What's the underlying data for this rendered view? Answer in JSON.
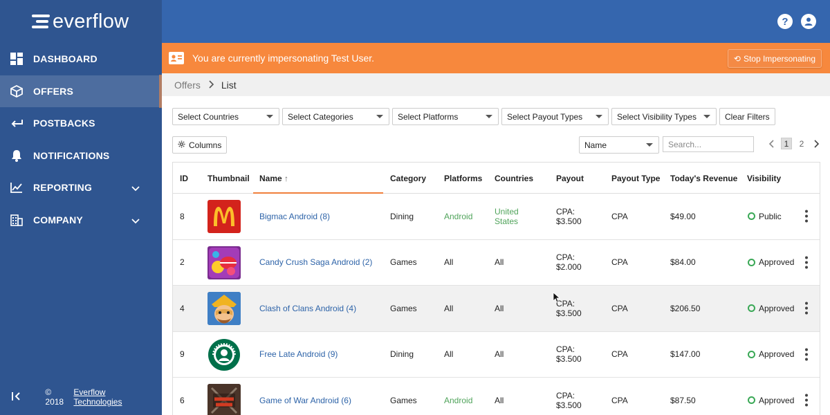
{
  "brand": {
    "name": "everflow"
  },
  "sidebar": {
    "items": [
      {
        "label": "DASHBOARD",
        "icon": "dashboard-icon"
      },
      {
        "label": "OFFERS",
        "icon": "cube-icon",
        "active": true
      },
      {
        "label": "POSTBACKS",
        "icon": "arrow-left-icon"
      },
      {
        "label": "NOTIFICATIONS",
        "icon": "bell-icon"
      },
      {
        "label": "REPORTING",
        "icon": "chart-icon",
        "expandable": true
      },
      {
        "label": "COMPANY",
        "icon": "building-icon",
        "expandable": true
      }
    ],
    "footer": {
      "copyright": "© 2018",
      "company_link": "Everflow Technologies"
    }
  },
  "topbar": {
    "help_glyph": "?"
  },
  "banner": {
    "text": "You are currently impersonating Test User.",
    "stop_button": "Stop Impersonating"
  },
  "breadcrumb": {
    "parent": "Offers",
    "current": "List"
  },
  "filters": {
    "countries": "Select Countries",
    "categories": "Select Categories",
    "platforms": "Select Platforms",
    "payout_types": "Select Payout Types",
    "visibility_types": "Select Visibility Types",
    "clear": "Clear Filters"
  },
  "toolbar": {
    "columns": "Columns",
    "sort_by": "Name",
    "search_placeholder": "Search...",
    "pages": [
      "1",
      "2"
    ]
  },
  "table": {
    "headers": {
      "id": "ID",
      "thumbnail": "Thumbnail",
      "name": "Name",
      "category": "Category",
      "platforms": "Platforms",
      "countries": "Countries",
      "payout": "Payout",
      "payout_type": "Payout Type",
      "revenue": "Today's Revenue",
      "visibility": "Visibility"
    },
    "rows": [
      {
        "id": "8",
        "name": "Bigmac Android (8)",
        "category": "Dining",
        "platforms": "Android",
        "countries_1": "United",
        "countries_2": "States",
        "payout_1": "CPA:",
        "payout_2": "$3.500",
        "payout_type": "CPA",
        "revenue": "$49.00",
        "visibility": "Public",
        "thumb": "mcdonalds"
      },
      {
        "id": "2",
        "name": "Candy Crush Saga Android (2)",
        "category": "Games",
        "platforms": "All",
        "countries_1": "All",
        "countries_2": "",
        "payout_1": "CPA:",
        "payout_2": "$2.000",
        "payout_type": "CPA",
        "revenue": "$84.00",
        "visibility": "Approved",
        "thumb": "candy-crush"
      },
      {
        "id": "4",
        "name": "Clash of Clans Android (4)",
        "category": "Games",
        "platforms": "All",
        "countries_1": "All",
        "countries_2": "",
        "payout_1": "CPA:",
        "payout_2": "$3.500",
        "payout_type": "CPA",
        "revenue": "$206.50",
        "visibility": "Approved",
        "thumb": "clash-of-clans"
      },
      {
        "id": "9",
        "name": "Free Late Android (9)",
        "category": "Dining",
        "platforms": "All",
        "countries_1": "All",
        "countries_2": "",
        "payout_1": "CPA:",
        "payout_2": "$3.500",
        "payout_type": "CPA",
        "revenue": "$147.00",
        "visibility": "Approved",
        "thumb": "starbucks"
      },
      {
        "id": "6",
        "name": "Game of War Android (6)",
        "category": "Games",
        "platforms": "Android",
        "countries_1": "All",
        "countries_2": "",
        "payout_1": "CPA:",
        "payout_2": "$3.500",
        "payout_type": "CPA",
        "revenue": "$87.50",
        "visibility": "Approved",
        "thumb": "game-of-war"
      }
    ]
  },
  "colors": {
    "sidebar": "#2f5590",
    "topbar": "#3566ae",
    "banner": "#f7883d",
    "link": "#2d63a8",
    "green": "#4fa35a"
  }
}
